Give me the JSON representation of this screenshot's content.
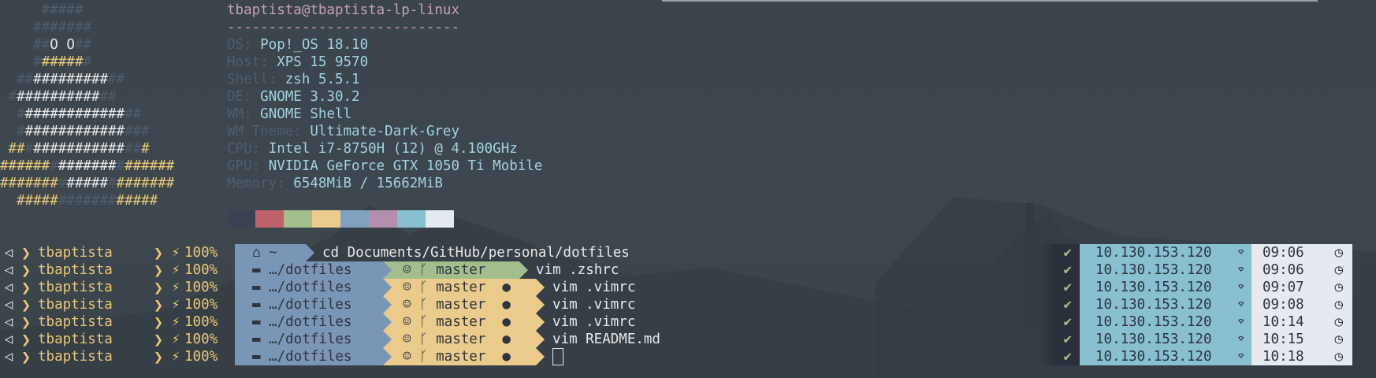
{
  "logo_rows": [
    [
      [
        "d",
        "     #####   "
      ]
    ],
    [
      [
        "d",
        "    #######  "
      ]
    ],
    [
      [
        "d",
        "    ##"
      ],
      [
        "w",
        "O"
      ],
      [
        "d",
        " "
      ],
      [
        "w",
        "O"
      ],
      [
        "d",
        "## "
      ]
    ],
    [
      [
        "d",
        "    #"
      ],
      [
        "y",
        "#####"
      ],
      [
        "d",
        "# "
      ]
    ],
    [
      [
        "d",
        "  ##"
      ],
      [
        "w",
        "#########"
      ],
      [
        "d",
        "##"
      ]
    ],
    [
      [
        "d",
        " #"
      ],
      [
        "w",
        "##########"
      ],
      [
        "d",
        "##"
      ]
    ],
    [
      [
        "d",
        "  #"
      ],
      [
        "w",
        "############"
      ],
      [
        "d",
        "##"
      ]
    ],
    [
      [
        "d",
        "  #"
      ],
      [
        "w",
        "############"
      ],
      [
        "d",
        "###"
      ]
    ],
    [
      [
        "y",
        " ##"
      ],
      [
        "d",
        "#"
      ],
      [
        "w",
        "###########"
      ],
      [
        "d",
        "##"
      ],
      [
        "y",
        "#"
      ]
    ],
    [
      [
        "y",
        "######"
      ],
      [
        "d",
        "#"
      ],
      [
        "w",
        "#######"
      ],
      [
        "d",
        "#"
      ],
      [
        "y",
        "######"
      ]
    ],
    [
      [
        "y",
        "#######"
      ],
      [
        "d",
        "#"
      ],
      [
        "w",
        "#####"
      ],
      [
        "d",
        "#"
      ],
      [
        "y",
        "#######"
      ]
    ],
    [
      [
        "y",
        "  #####"
      ],
      [
        "d",
        "#######"
      ],
      [
        "y",
        "#####"
      ]
    ]
  ],
  "info": {
    "title": "tbaptista@tbaptista-lp-linux",
    "separator": "----------------------------",
    "fields": [
      {
        "label": "OS: ",
        "value": "Pop!_OS 18.10"
      },
      {
        "label": "Host: ",
        "value": "XPS 15 9570"
      },
      {
        "label": "Shell: ",
        "value": "zsh 5.5.1"
      },
      {
        "label": "DE: ",
        "value": "GNOME 3.30.2"
      },
      {
        "label": "WM: ",
        "value": "GNOME Shell"
      },
      {
        "label": "WM Theme: ",
        "value": "Ultimate-Dark-Grey"
      },
      {
        "label": "CPU: ",
        "value": "Intel i7-8750H (12) @ 4.100GHz"
      },
      {
        "label": "GPU: ",
        "value": "NVIDIA GeForce GTX 1050 Ti Mobile"
      },
      {
        "label": "Memory: ",
        "value": "6548MiB / 15662MiB"
      }
    ],
    "swatch_colors": [
      "#3b4252",
      "#bf616a",
      "#a3be8c",
      "#ebcb8b",
      "#81a1c1",
      "#b48ead",
      "#88c0d0",
      "#e5e9f0"
    ]
  },
  "prompt": {
    "user": "tbaptista",
    "battery": "100%",
    "home_dir": "~",
    "lines": [
      {
        "dir": "~",
        "branch": null,
        "state": null,
        "cmd": "cd Documents/GitHub/personal/dotfiles",
        "ip": "10.130.153.120",
        "time": "09:06"
      },
      {
        "dir": "…/dotfiles",
        "branch": "master",
        "state": "ok",
        "cmd": "vim .zshrc",
        "ip": "10.130.153.120",
        "time": "09:06"
      },
      {
        "dir": "…/dotfiles",
        "branch": "master",
        "state": "mod",
        "cmd": "vim .vimrc",
        "ip": "10.130.153.120",
        "time": "09:07"
      },
      {
        "dir": "…/dotfiles",
        "branch": "master",
        "state": "mod",
        "cmd": "vim .vimrc",
        "ip": "10.130.153.120",
        "time": "09:08"
      },
      {
        "dir": "…/dotfiles",
        "branch": "master",
        "state": "mod",
        "cmd": "vim .vimrc",
        "ip": "10.130.153.120",
        "time": "10:14"
      },
      {
        "dir": "…/dotfiles",
        "branch": "master",
        "state": "mod",
        "cmd": "vim README.md",
        "ip": "10.130.153.120",
        "time": "10:15"
      },
      {
        "dir": "…/dotfiles",
        "branch": "master",
        "state": "mod",
        "cmd": "",
        "ip": "10.130.153.120",
        "time": "10:18",
        "cursor": true
      }
    ]
  },
  "icons": {
    "os": "apple-like-prompt-icon",
    "chevron": "chevron-right-icon",
    "plug": "plug-icon",
    "home": "home-icon",
    "folder": "folder-icon",
    "github": "github-icon",
    "branch": "git-branch-icon",
    "modified": "modified-icon",
    "check": "check-icon",
    "wifi": "wifi-icon",
    "clock": "clock-icon"
  }
}
